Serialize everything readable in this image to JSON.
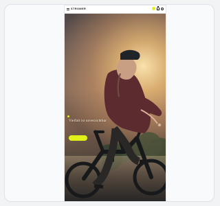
{
  "header": {
    "brand": "STROMER"
  },
  "hero": {
    "headline": "Vielfalt ist unverzichtbar",
    "subtitle": "",
    "button_label": ""
  },
  "colors": {
    "page_background": "#f1f3f5",
    "card_background": "#f8fafc",
    "accent": "#e2f019",
    "phone_bar": "#ffffff"
  },
  "icons": {
    "menu": "menu-icon",
    "cta": "cta-dot-icon",
    "bag": "bag-icon",
    "account": "account-icon"
  }
}
